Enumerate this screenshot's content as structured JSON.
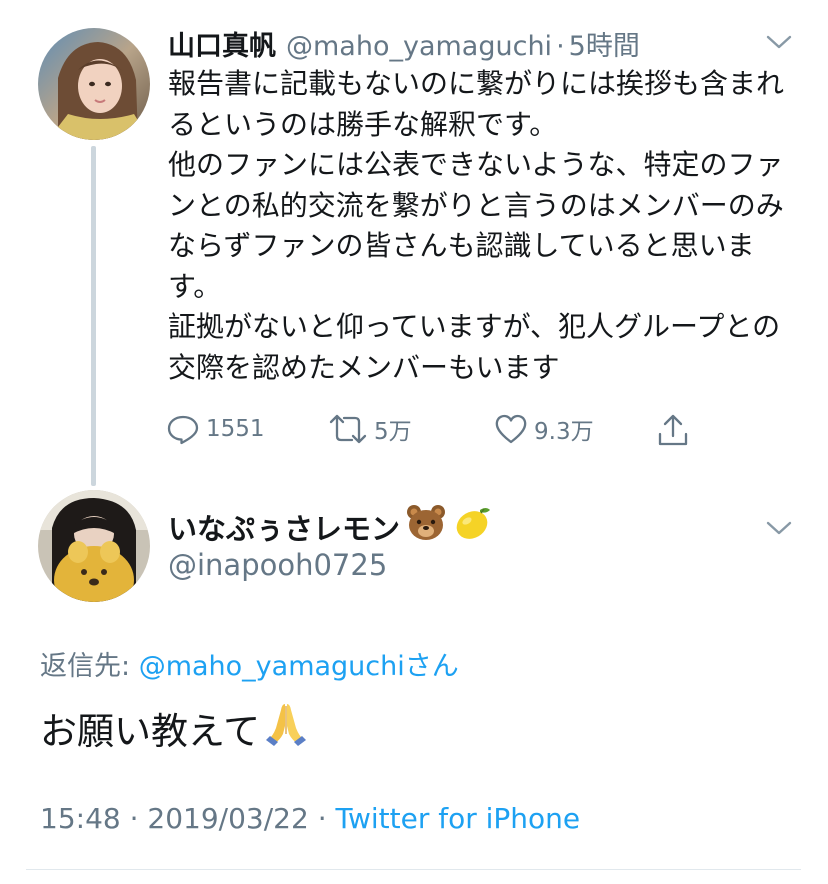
{
  "colors": {
    "text": "#14171a",
    "secondary": "#657786",
    "link": "#1da1f2",
    "thread_line": "#ccd6dd",
    "divider": "#e1e8ed"
  },
  "parent_tweet": {
    "display_name": "山口真帆",
    "handle": "@maho_yamaguchi",
    "separator": "·",
    "time": "5時間",
    "text": "報告書に記載もないのに繋がりには挨拶も含まれるというのは勝手な解釈です。\n他のファンには公表できないような、特定のファンとの私的交流を繋がりと言うのはメンバーのみならずファンの皆さんも認識していると思います。\n証拠がないと仰っていますが、犯人グループとの交際を認めたメンバーもいます",
    "actions": {
      "reply_icon": "reply-icon",
      "reply_count": "1551",
      "retweet_icon": "retweet-icon",
      "retweet_count": "5万",
      "like_icon": "heart-icon",
      "like_count": "9.3万",
      "share_icon": "share-icon"
    }
  },
  "reply_tweet": {
    "display_name": "いなぷぅさレモン",
    "emoji_1": "bear-face-emoji",
    "emoji_2": "lemon-emoji",
    "handle": "@inapooh0725",
    "reply_to_label": "返信先: ",
    "reply_to_mention": "@maho_yamaguchi",
    "reply_to_suffix": "さん",
    "text": "お願い教えて",
    "text_emoji": "folded-hands-emoji",
    "time": "15:48",
    "meta_separator_1": " · ",
    "date": "2019/03/22",
    "meta_separator_2": " · ",
    "source": "Twitter for iPhone"
  }
}
